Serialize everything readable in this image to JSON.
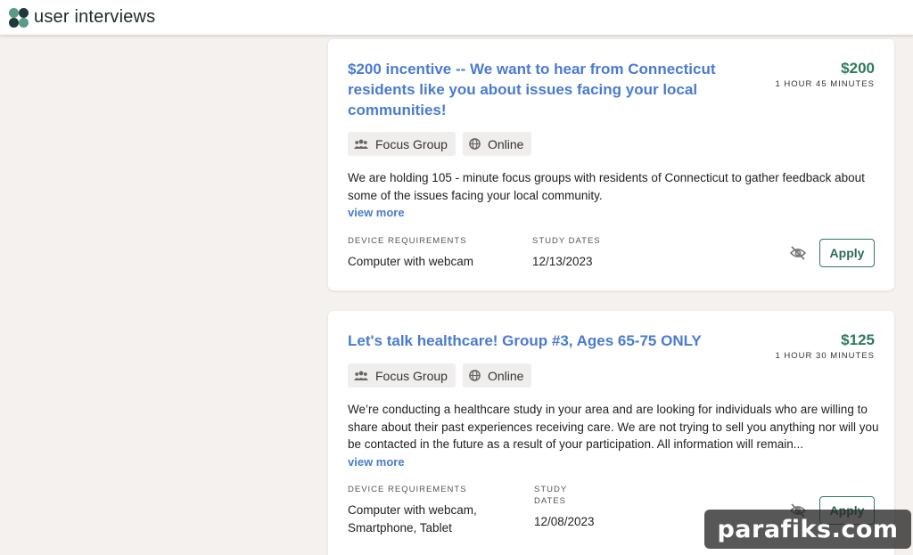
{
  "app": {
    "name": "user interviews",
    "colors": {
      "logo_teal": "#5a9a86",
      "logo_dark": "#1f3a3a",
      "link_blue": "#4a7bd0",
      "price_green": "#2f7a5b"
    }
  },
  "studies": [
    {
      "title": "$200 incentive -- We want to hear from Connecticut residents like you about issues facing your local communities!",
      "price": "$200",
      "duration": "1 HOUR 45 MINUTES",
      "tags": [
        {
          "label": "Focus Group",
          "icon": "people-icon"
        },
        {
          "label": "Online",
          "icon": "globe-icon"
        }
      ],
      "description": "We are holding 105 - minute focus groups with residents of Connecticut to gather feedback about some of the issues facing your local community.",
      "view_more": "view more",
      "device_requirements_label": "DEVICE REQUIREMENTS",
      "device_requirements": "Computer with webcam",
      "study_dates_label": "STUDY DATES",
      "study_dates": "12/13/2023",
      "hide_icon": "eye-slash-icon",
      "apply_label": "Apply"
    },
    {
      "title": "Let's talk healthcare! Group #3, Ages 65-75 ONLY",
      "price": "$125",
      "duration": "1 HOUR 30 MINUTES",
      "tags": [
        {
          "label": "Focus Group",
          "icon": "people-icon"
        },
        {
          "label": "Online",
          "icon": "globe-icon"
        }
      ],
      "description": "We’re conducting a healthcare study in your area and are looking for individuals who are willing to share about their past experiences receiving care. We are not trying to sell you anything nor will you be contacted in the future as a result of your participation. All information will remain...",
      "view_more": "view more",
      "device_requirements_label": "DEVICE REQUIREMENTS",
      "device_requirements": "Computer with webcam, Smartphone, Tablet",
      "study_dates_label": "STUDY DATES",
      "study_dates": "12/08/2023",
      "hide_icon": "eye-slash-icon",
      "apply_label": "Apply"
    }
  ],
  "watermark": "parafiks.com"
}
